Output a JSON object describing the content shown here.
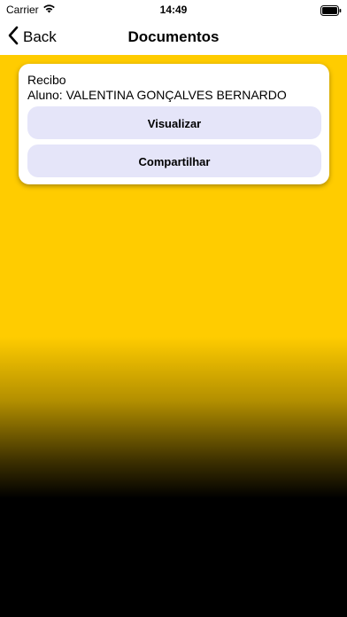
{
  "status_bar": {
    "carrier": "Carrier",
    "time": "14:49",
    "icons": [
      "wifi-icon",
      "battery-icon"
    ]
  },
  "nav": {
    "back_label": "Back",
    "title": "Documentos",
    "back_icon": "chevron-left-icon"
  },
  "document_card": {
    "title": "Recibo",
    "subtitle": "Aluno: VALENTINA GONÇALVES BERNARDO",
    "view_label": "Visualizar",
    "share_label": "Compartilhar"
  },
  "colors": {
    "background_top": "#ffcc00",
    "background_bottom": "#000000",
    "button_bg": "#e5e5f9"
  }
}
